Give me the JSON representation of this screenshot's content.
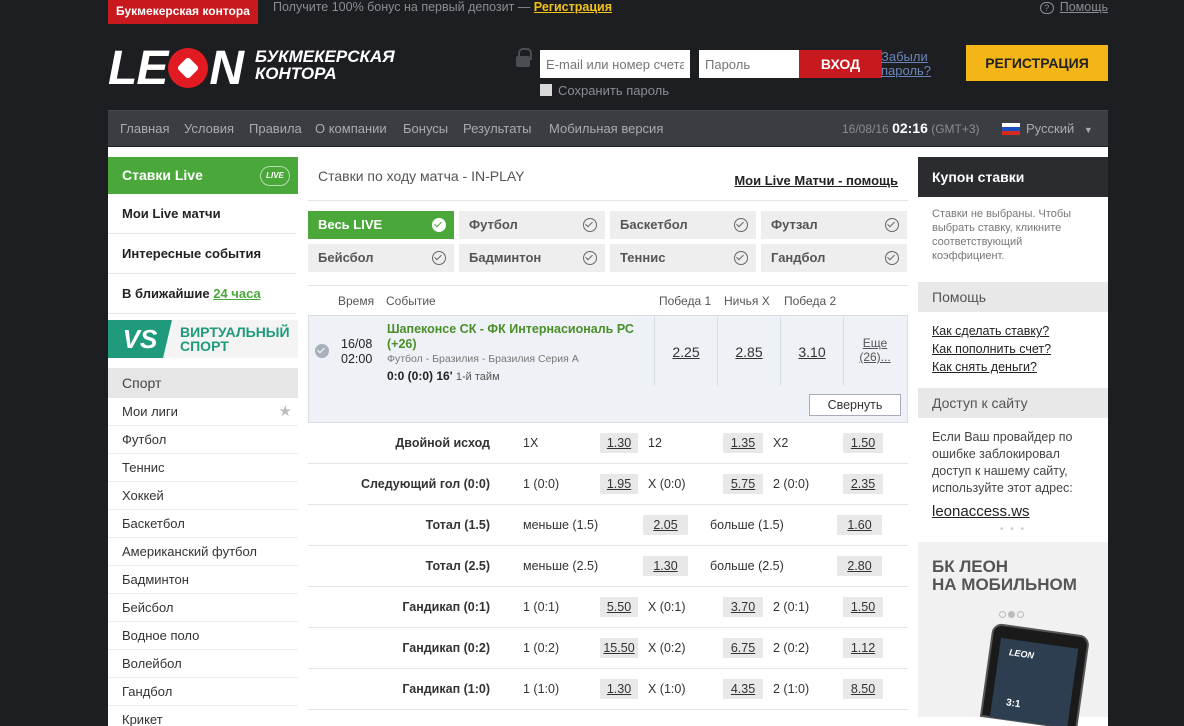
{
  "topbar": {
    "brand": "Букмекерская контора",
    "bonus_text": "Получите 100% бонус на первый депозит — ",
    "bonus_link": "Регистрация",
    "help": "Помощь"
  },
  "header": {
    "logo_prefix": "LE",
    "logo_suffix": "N",
    "logo_sub_line1": "БУКМЕКЕРСКАЯ",
    "logo_sub_line2": "КОНТОРА",
    "email_placeholder": "E-mail или номер счета",
    "password_placeholder": "Пароль",
    "login_button": "ВХОД",
    "remember": "Сохранить пароль",
    "forgot": "Забыли пароль?",
    "register_button": "РЕГИСТРАЦИЯ"
  },
  "nav": {
    "items": [
      "Главная",
      "Условия",
      "Правила",
      "О компании",
      "Бонусы",
      "Результаты",
      "Мобильная версия"
    ],
    "date": "16/08/16",
    "time": "02:16",
    "tz": "(GMT+3)",
    "language": "Русский"
  },
  "left": {
    "live_title": "Ставки Live",
    "live_icon": "LIVE",
    "items": [
      "Мои Live матчи",
      "Интересные события"
    ],
    "soon_prefix": "В ближайшие ",
    "soon_link": "24 часа",
    "vs_badge": "VS",
    "vs_line1": "ВИРТУАЛЬНЫЙ",
    "vs_line2": "СПОРТ",
    "sport_title": "Спорт",
    "sports": [
      "Мои лиги",
      "Футбол",
      "Теннис",
      "Хоккей",
      "Баскетбол",
      "Американский футбол",
      "Бадминтон",
      "Бейсбол",
      "Водное поло",
      "Волейбол",
      "Гандбол",
      "Крикет"
    ]
  },
  "center": {
    "title": "Ставки по ходу матча - IN-PLAY",
    "help_link": "Мои Live Матчи - помощь",
    "filters": [
      "Весь LIVE",
      "Футбол",
      "Баскетбол",
      "Футзал",
      "Бейсбол",
      "Бадминтон",
      "Теннис",
      "Гандбол"
    ],
    "columns": {
      "time": "Время",
      "event": "Событие",
      "win1": "Победа 1",
      "draw": "Ничья Х",
      "win2": "Победа 2"
    },
    "event": {
      "date": "16/08",
      "time": "02:00",
      "name": "Шапеконсе СК - ФК Интернасиональ РС (+26)",
      "meta": "Футбол - Бразилия - Бразилия Серия А",
      "score": "0:0 (0:0) 16'",
      "half": "1-й тайм",
      "odds": [
        "2.25",
        "2.85",
        "3.10"
      ],
      "more": "Еще (26)...",
      "collapse": "Свернуть"
    },
    "markets": [
      {
        "label": "Двойной исход",
        "cells": [
          [
            "1X",
            "1.30"
          ],
          [
            "12",
            "1.35"
          ],
          [
            "X2",
            "1.50"
          ]
        ]
      },
      {
        "label": "Следующий гол (0:0)",
        "cells": [
          [
            "1 (0:0)",
            "1.95"
          ],
          [
            "X (0:0)",
            "5.75"
          ],
          [
            "2 (0:0)",
            "2.35"
          ]
        ]
      },
      {
        "label": "Тотал (1.5)",
        "cells": [
          [
            "меньше (1.5)",
            "2.05"
          ],
          [
            "больше (1.5)",
            "1.60"
          ]
        ]
      },
      {
        "label": "Тотал (2.5)",
        "cells": [
          [
            "меньше (2.5)",
            "1.30"
          ],
          [
            "больше (2.5)",
            "2.80"
          ]
        ]
      },
      {
        "label": "Гандикап (0:1)",
        "cells": [
          [
            "1 (0:1)",
            "5.50"
          ],
          [
            "X (0:1)",
            "3.70"
          ],
          [
            "2 (0:1)",
            "1.50"
          ]
        ]
      },
      {
        "label": "Гандикап (0:2)",
        "cells": [
          [
            "1 (0:2)",
            "15.50"
          ],
          [
            "X (0:2)",
            "6.75"
          ],
          [
            "2 (0:2)",
            "1.12"
          ]
        ]
      },
      {
        "label": "Гандикап (1:0)",
        "cells": [
          [
            "1 (1:0)",
            "1.30"
          ],
          [
            "X (1:0)",
            "4.35"
          ],
          [
            "2 (1:0)",
            "8.50"
          ]
        ]
      }
    ]
  },
  "right": {
    "coupon_title": "Купон ставки",
    "coupon_text": "Ставки не выбраны. Чтобы выбрать ставку, кликните соответствующий коэффициент.",
    "help_title": "Помощь",
    "help_links": [
      "Как сделать ставку?",
      "Как пополнить счет?",
      "Как снять деньги?"
    ],
    "access_title": "Доступ к сайту",
    "access_text": "Если Ваш провайдер по ошибке заблокировал доступ к нашему сайту, используйте этот адрес:",
    "access_link": "leonaccess.ws",
    "promo_line1": "БК ЛЕОН",
    "promo_line2": "НА МОБИЛЬНОМ",
    "phone_logo": "LEON",
    "phone_score": "3:1"
  }
}
